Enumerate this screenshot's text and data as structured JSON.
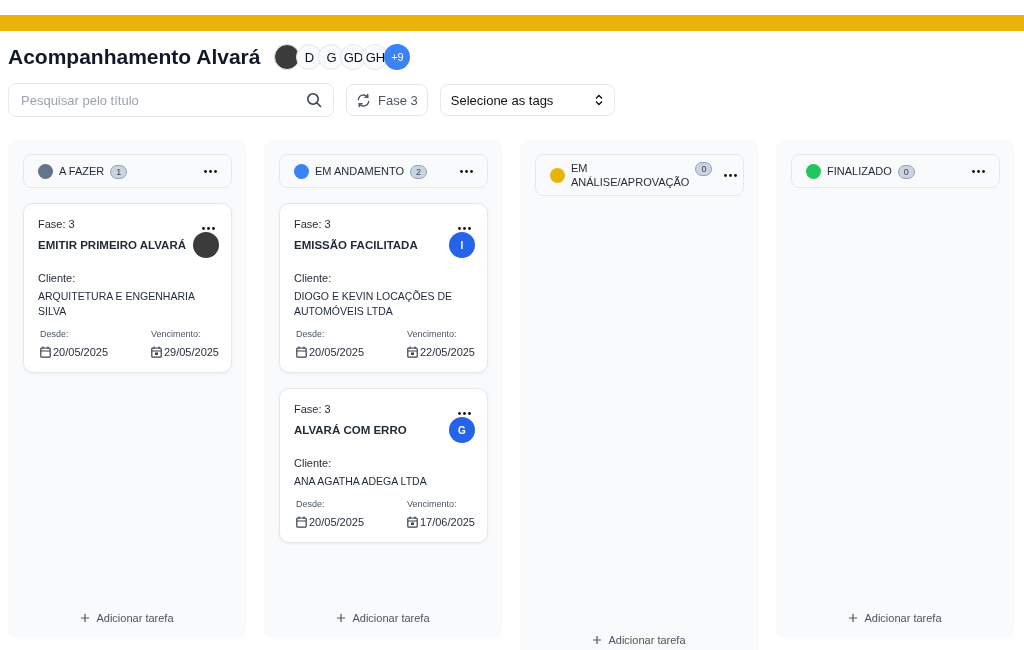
{
  "title": "Acompanhamento Alvará",
  "members": [
    {
      "kind": "photo"
    },
    {
      "kind": "initials",
      "text": "D"
    },
    {
      "kind": "initials",
      "text": "G"
    },
    {
      "kind": "initials",
      "text": "GD"
    },
    {
      "kind": "initials",
      "text": "GH"
    },
    {
      "kind": "more",
      "text": "+9"
    }
  ],
  "search": {
    "placeholder": "Pesquisar pelo título"
  },
  "phase_button": "Fase 3",
  "tags_select": "Selecione as tags",
  "columns": [
    {
      "title": "A FAZER",
      "color": "#64748b",
      "count": "1",
      "add_label": "Adicionar tarefa",
      "cards": [
        {
          "phase": "Fase: 3",
          "title": "EMITIR PRIMEIRO ALVARÁ",
          "assignee": {
            "kind": "photo"
          },
          "client_label": "Cliente:",
          "client": "ARQUITETURA E ENGENHARIA SILVA",
          "since_label": "Desde:",
          "since": "20/05/2025",
          "due_label": "Vencimento:",
          "due": "29/05/2025"
        }
      ]
    },
    {
      "title": "EM ANDAMENTO",
      "color": "#3b82f6",
      "count": "2",
      "add_label": "Adicionar tarefa",
      "cards": [
        {
          "phase": "Fase: 3",
          "title": "EMISSÃO FACILITADA",
          "assignee": {
            "kind": "initials",
            "text": "I"
          },
          "client_label": "Cliente:",
          "client": "DIOGO E KEVIN LOCAÇÕES DE AUTOMÓVEIS LTDA",
          "since_label": "Desde:",
          "since": "20/05/2025",
          "due_label": "Vencimento:",
          "due": "22/05/2025"
        },
        {
          "phase": "Fase: 3",
          "title": "ALVARÁ COM ERRO",
          "assignee": {
            "kind": "initials",
            "text": "G"
          },
          "client_label": "Cliente:",
          "client": "ANA AGATHA ADEGA LTDA",
          "since_label": "Desde:",
          "since": "20/05/2025",
          "due_label": "Vencimento:",
          "due": "17/06/2025"
        }
      ]
    },
    {
      "title": "EM ANÁLISE/APROVAÇÃO",
      "color": "#eab308",
      "count": "0",
      "add_label": "Adicionar tarefa"
    },
    {
      "title": "FINALIZADO",
      "color": "#22c55e",
      "count": "0",
      "add_label": "Adicionar tarefa"
    }
  ]
}
